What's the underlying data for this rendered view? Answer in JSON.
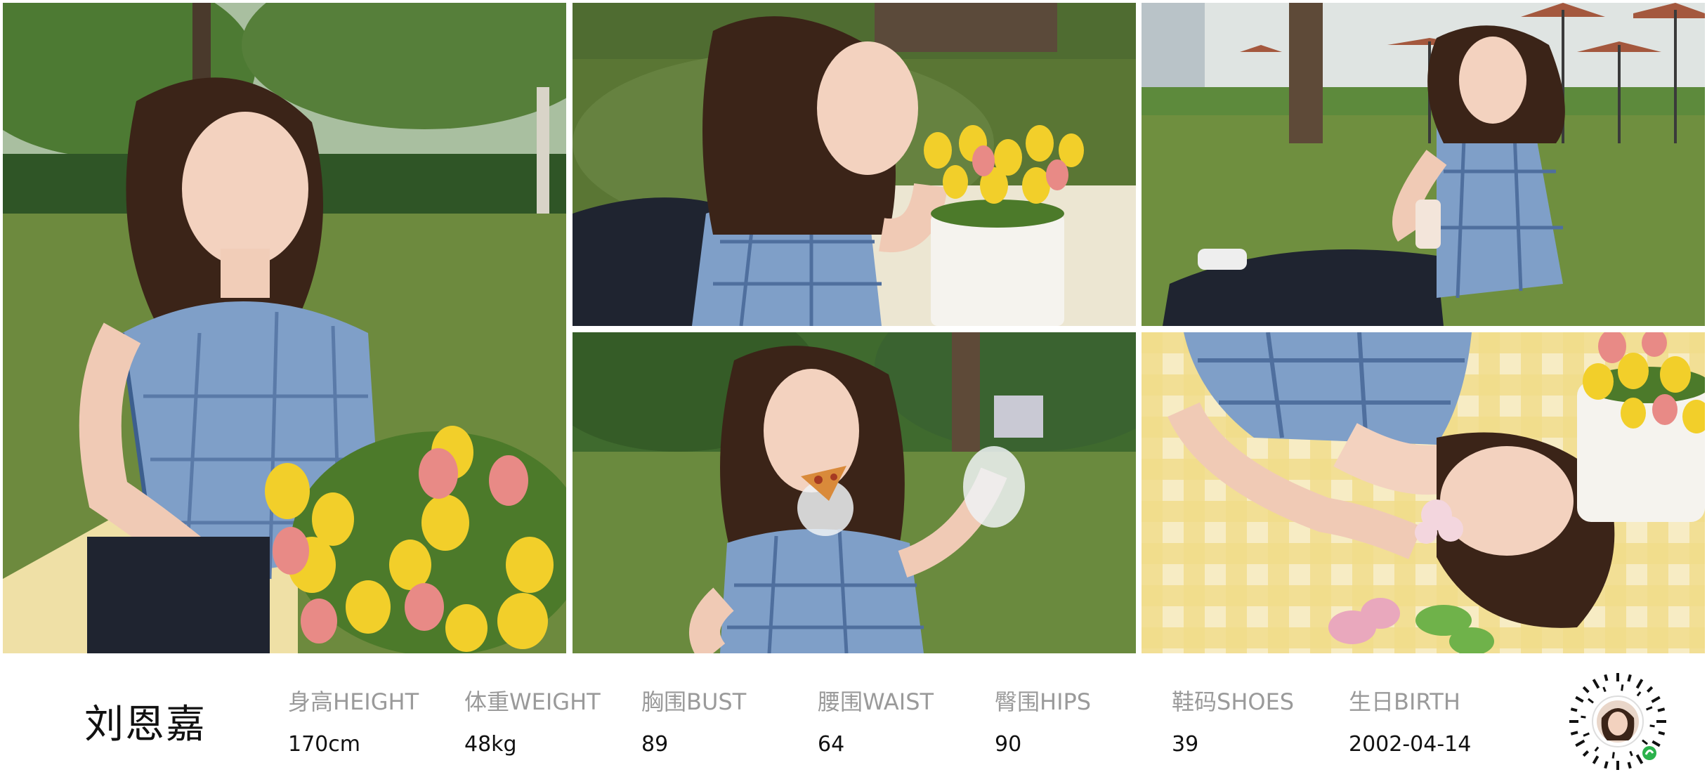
{
  "profile": {
    "name": "刘恩嘉",
    "stats": [
      {
        "label": "身高HEIGHT",
        "value": "170cm"
      },
      {
        "label": "体重WEIGHT",
        "value": "48kg"
      },
      {
        "label": "胸围BUST",
        "value": "89"
      },
      {
        "label": "腰围WAIST",
        "value": "64"
      },
      {
        "label": "臀围HIPS",
        "value": "90"
      },
      {
        "label": "鞋码SHOES",
        "value": "39"
      },
      {
        "label": "生日BIRTH",
        "value": "2002-04-14"
      }
    ]
  },
  "photos": [
    {
      "icon": "portrait-with-tulips-photo"
    },
    {
      "icon": "lying-on-grass-photo"
    },
    {
      "icon": "park-with-umbrellas-photo"
    },
    {
      "icon": "eating-pizza-photo"
    },
    {
      "icon": "lying-on-blanket-photo"
    }
  ],
  "colors": {
    "grass": "#5f7d3a",
    "foliage": "#3f6a2e",
    "plaid_blue": "#7f9fc8",
    "tulip_yellow": "#f2cf2a",
    "tulip_pink": "#e88a86",
    "blanket_yellow": "#f1dc8a",
    "hair": "#3b2418",
    "skin": "#f3d2bf"
  }
}
